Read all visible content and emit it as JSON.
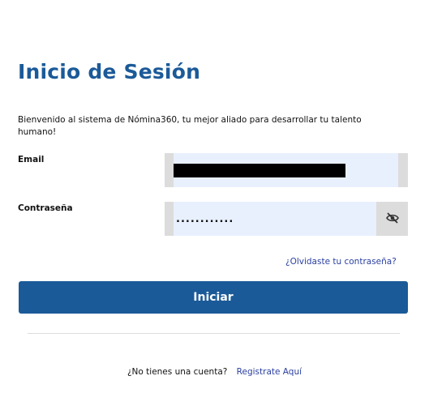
{
  "title": "Inicio de Sesión",
  "welcome": "Bienvenido al sistema de Nómina360, tu mejor aliado para desarrollar tu talento humano!",
  "email": {
    "label": "Email",
    "value": ""
  },
  "password": {
    "label": "Contraseña",
    "value": "............"
  },
  "icons": {
    "toggle_password": "eye-slash-icon"
  },
  "forgot_link": "¿Olvidaste tu contraseña?",
  "submit_label": "Iniciar",
  "signup": {
    "question": "¿No tienes una cuenta?",
    "link": "Registrate Aquí"
  },
  "colors": {
    "primary": "#1b5a98",
    "link": "#2a3fa0",
    "field_bg": "#e8f0fe"
  }
}
